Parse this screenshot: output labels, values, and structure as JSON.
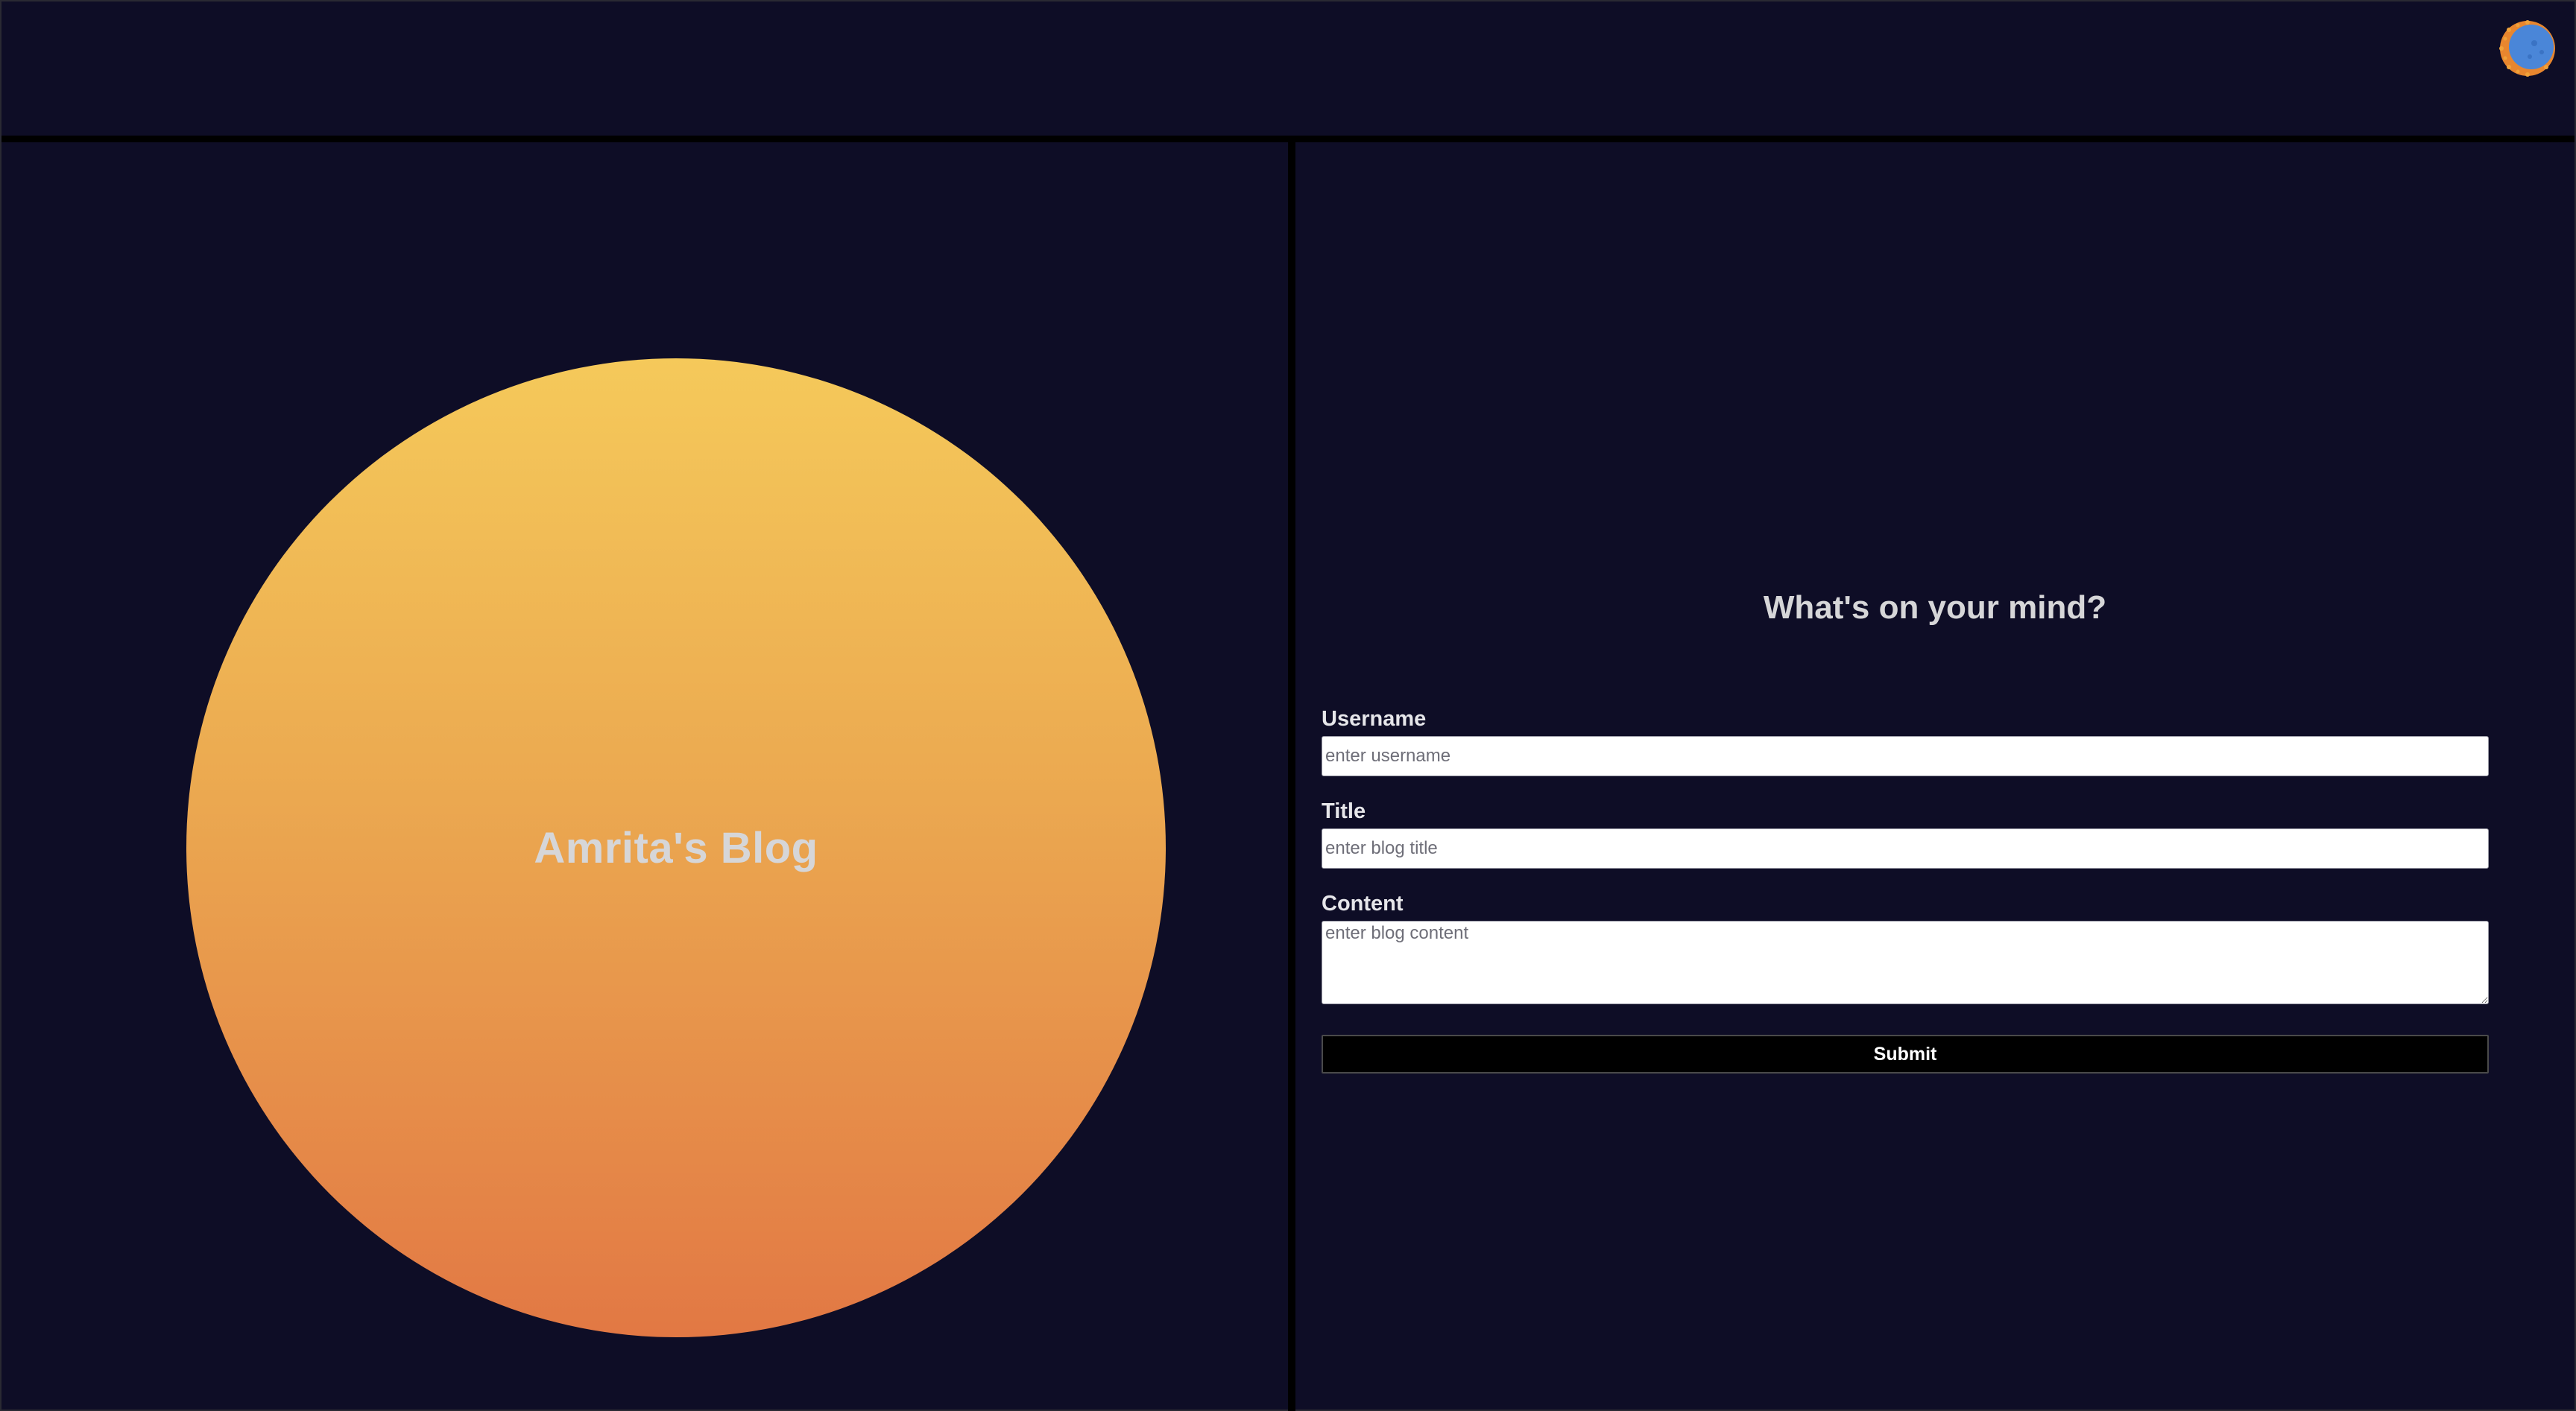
{
  "header": {
    "theme_toggle_icon": "sun-moon-toggle-icon"
  },
  "hero": {
    "title": "Amrita's Blog",
    "gradient_colors": [
      "#f5c95a",
      "#e27844"
    ]
  },
  "form": {
    "heading": "What's on your mind?",
    "username": {
      "label": "Username",
      "placeholder": "enter username",
      "value": ""
    },
    "title": {
      "label": "Title",
      "placeholder": "enter blog title",
      "value": ""
    },
    "content": {
      "label": "Content",
      "placeholder": "enter blog content",
      "value": ""
    },
    "submit_label": "Submit"
  },
  "colors": {
    "background": "#0e0d26",
    "divider": "#000000",
    "button": "#000000"
  }
}
